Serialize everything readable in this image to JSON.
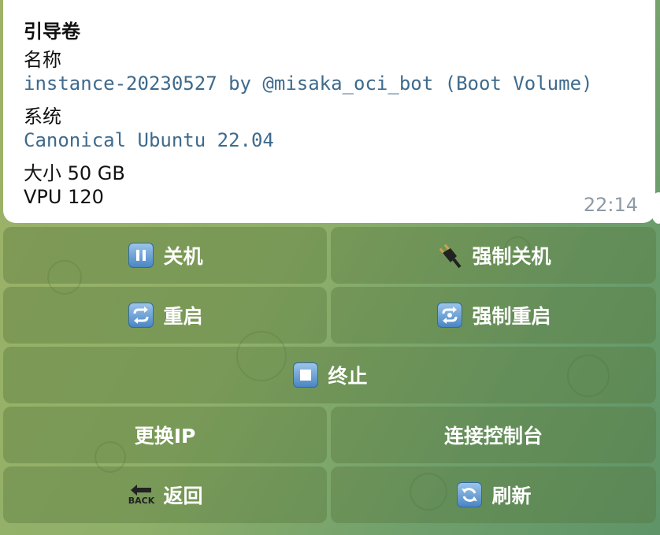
{
  "message": {
    "title": "引导卷",
    "name_label": "名称",
    "name_value": "instance-20230527 by @misaka_oci_bot (Boot Volume)",
    "os_label": "系统",
    "os_value": "Canonical Ubuntu 22.04",
    "size": "大小 50 GB",
    "vpu": "VPU 120",
    "time": "22:14"
  },
  "keyboard": {
    "shutdown": "关机",
    "force_shutdown": "强制关机",
    "reboot": "重启",
    "force_reboot": "强制重启",
    "terminate": "终止",
    "change_ip": "更换IP",
    "connect_console": "连接控制台",
    "back": "返回",
    "back_icon_text": "BACK",
    "refresh": "刷新"
  },
  "colors": {
    "link_text": "#3e6a8c",
    "timestamp": "#8e9aa6",
    "emoji_blue": "#4a86c4"
  },
  "icons": {
    "shutdown": "pause-button-icon",
    "force_shutdown": "electric-plug-icon",
    "reboot": "repeat-button-icon",
    "force_reboot": "repeat-single-button-icon",
    "terminate": "stop-button-icon",
    "back": "back-arrow-icon",
    "refresh": "counterclockwise-arrows-button-icon"
  }
}
